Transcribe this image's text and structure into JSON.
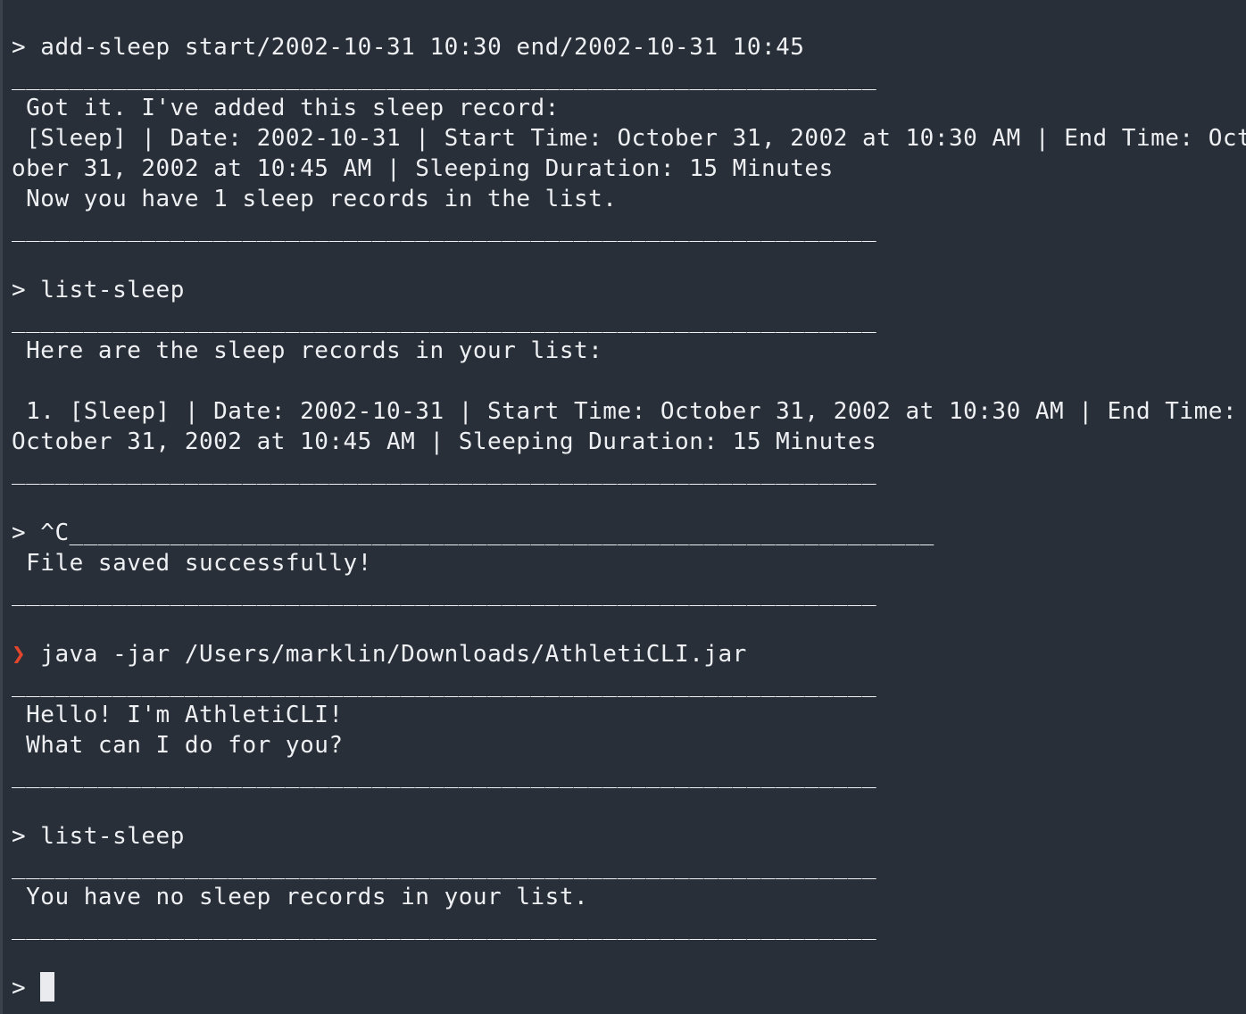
{
  "terminal": {
    "prompt_symbol": ">",
    "shell_prompt_symbol": "❯",
    "accent_color": "#e2462d",
    "background_color": "#282f38",
    "text_color": "#eef0f3",
    "separator": "____________________________________________________________",
    "lines": {
      "cmd1": " add-sleep start/2002-10-31 10:30 end/2002-10-31 10:45",
      "out1_a": " Got it. I've added this sleep record:",
      "out1_b": " [Sleep] | Date: 2002-10-31 | Start Time: October 31, 2002 at 10:30 AM | End Time: Oct",
      "out1_c": "ober 31, 2002 at 10:45 AM | Sleeping Duration: 15 Minutes",
      "out1_d": " Now you have 1 sleep records in the list.",
      "cmd2": " list-sleep",
      "out2_a": " Here are the sleep records in your list:",
      "out2_b": " 1. [Sleep] | Date: 2002-10-31 | Start Time: October 31, 2002 at 10:30 AM | End Time:",
      "out2_c": "October 31, 2002 at 10:45 AM | Sleeping Duration: 15 Minutes",
      "cmd3": " ^C____________________________________________________________",
      "out3_a": " File saved successfully!",
      "shell_cmd": " java -jar /Users/marklin/Downloads/AthletiCLI.jar",
      "out4_a": " Hello! I'm AthletiCLI!",
      "out4_b": " What can I do for you?",
      "cmd4": " list-sleep",
      "out5_a": " You have no sleep records in your list."
    }
  }
}
